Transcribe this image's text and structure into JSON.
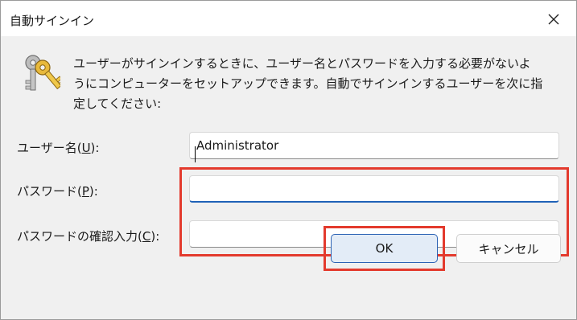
{
  "window": {
    "title": "自動サインイン",
    "close_icon": "close-icon"
  },
  "description": {
    "icon": "keys-icon",
    "lines": [
      "ユーザーがサインインするときに、ユーザー名とパスワードを入力する必要がないよ",
      "うにコンピューターをセットアップできます。自動でサインインするユーザーを次に指",
      "定してください:"
    ]
  },
  "form": {
    "username": {
      "label_text": "ユーザー名(",
      "accesskey": "U",
      "label_suffix": "):",
      "value": "Administrator"
    },
    "password": {
      "label_text": "パスワード(",
      "accesskey": "P",
      "label_suffix": "):",
      "value": ""
    },
    "confirm": {
      "label_text": "パスワードの確認入力(",
      "accesskey": "C",
      "label_suffix": "):",
      "value": ""
    }
  },
  "buttons": {
    "ok_label": "OK",
    "cancel_label": "キャンセル"
  },
  "colors": {
    "highlight": "#e33a2d",
    "accent": "#1f62b8",
    "dialog_bg": "#f0f0f0"
  }
}
